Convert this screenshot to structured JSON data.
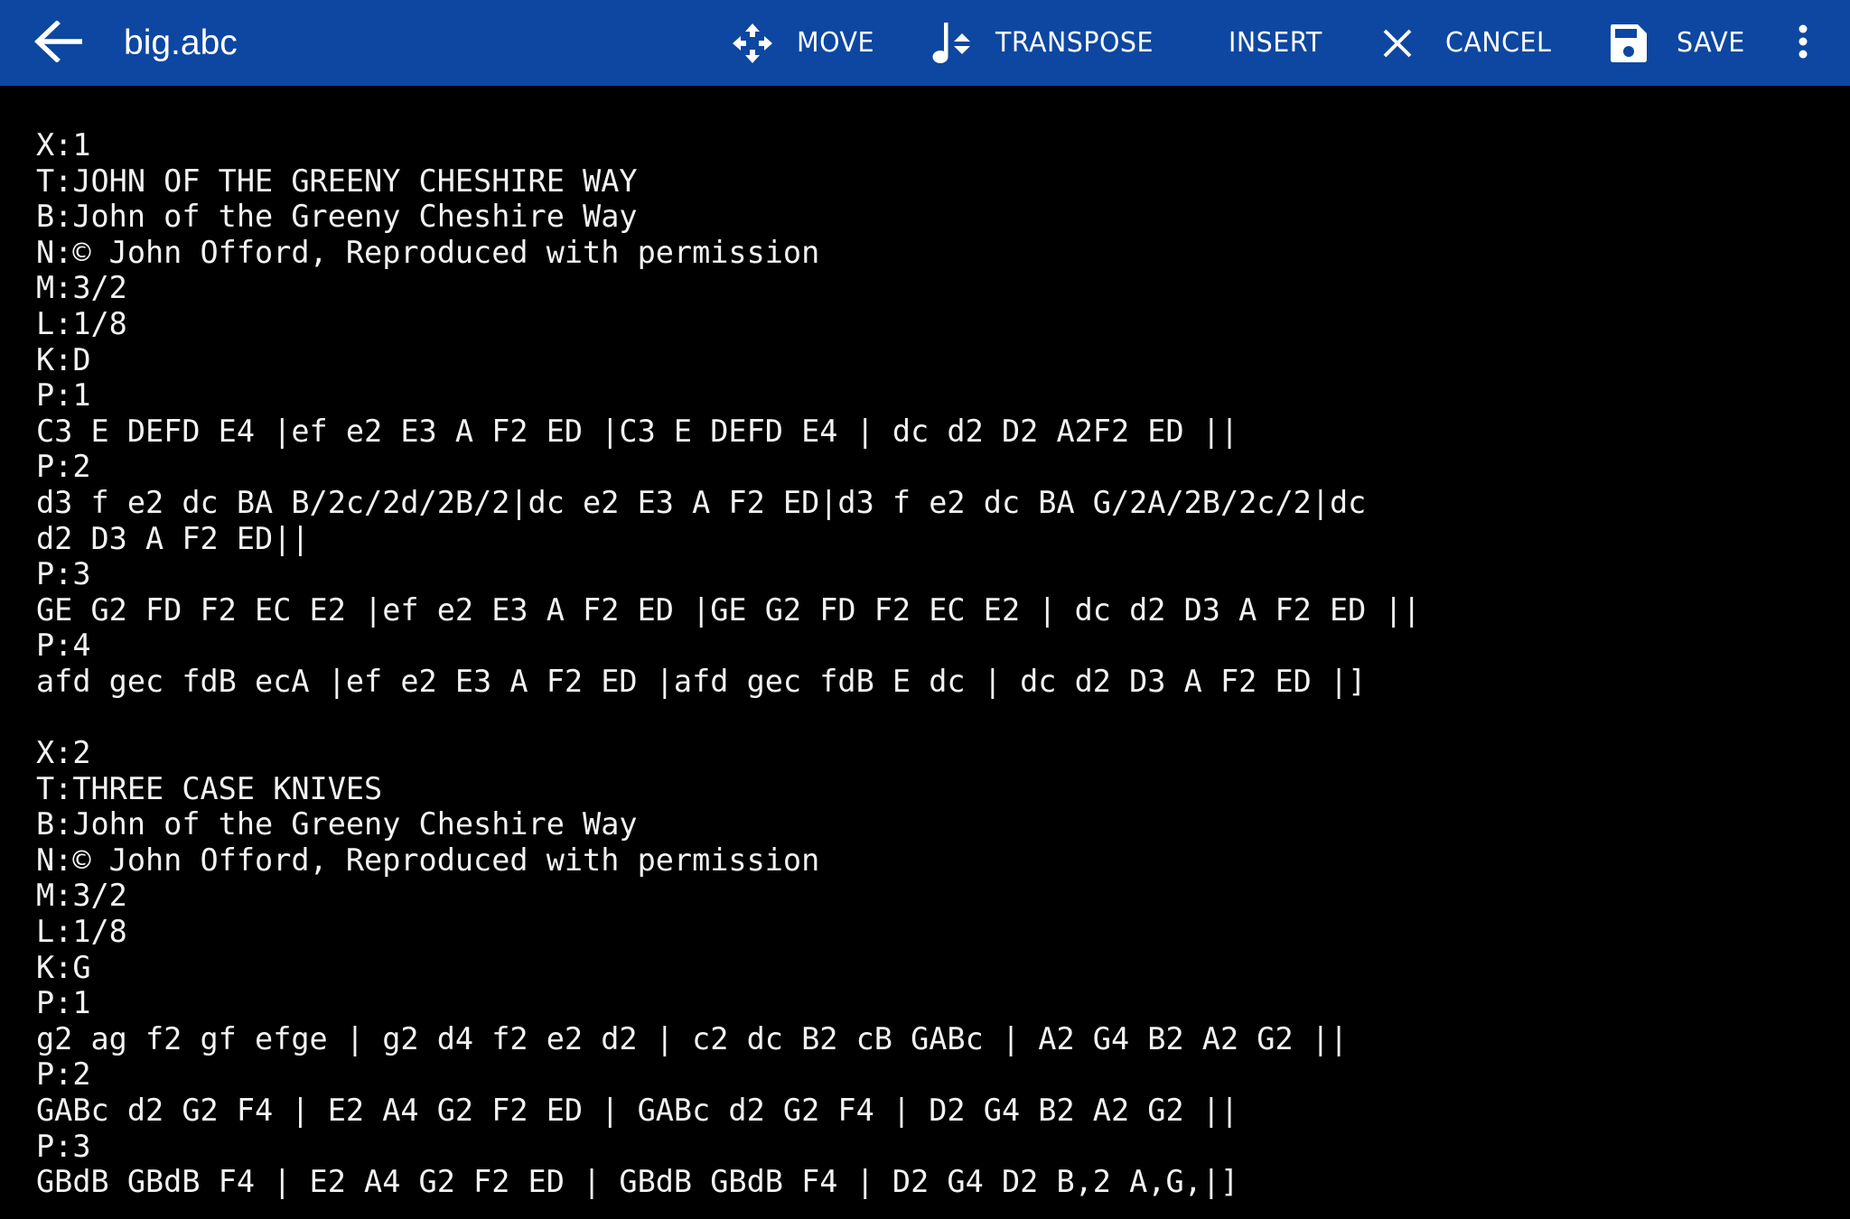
{
  "toolbar": {
    "back_icon": "arrow-left-icon",
    "title": "big.abc",
    "actions": [
      {
        "id": "move",
        "label": "MOVE",
        "icon": "move-arrows-icon"
      },
      {
        "id": "transpose",
        "label": "TRANSPOSE",
        "icon": "note-transpose-icon"
      },
      {
        "id": "insert",
        "label": "INSERT",
        "icon": null
      },
      {
        "id": "cancel",
        "label": "CANCEL",
        "icon": "close-icon"
      },
      {
        "id": "save",
        "label": "SAVE",
        "icon": "floppy-disk-icon"
      }
    ],
    "overflow_icon": "more-vert-icon",
    "background_color": "#0D47A1"
  },
  "editor": {
    "lines": [
      "X:1",
      "T:JOHN OF THE GREENY CHESHIRE WAY",
      "B:John of the Greeny Cheshire Way",
      "N:© John Offord, Reproduced with permission",
      "M:3/2",
      "L:1/8",
      "K:D",
      "P:1",
      "C3 E DEFD E4 |ef e2 E3 A F2 ED |C3 E DEFD E4 | dc d2 D2 A2F2 ED ||",
      "P:2",
      "d3 f e2 dc BA B/2c/2d/2B/2|dc e2 E3 A F2 ED|d3 f e2 dc BA G/2A/2B/2c/2|dc",
      "d2 D3 A F2 ED||",
      "P:3",
      "GE G2 FD F2 EC E2 |ef e2 E3 A F2 ED |GE G2 FD F2 EC E2 | dc d2 D3 A F2 ED ||",
      "P:4",
      "afd gec fdB ecA |ef e2 E3 A F2 ED |afd gec fdB E dc | dc d2 D3 A F2 ED |]",
      "",
      "X:2",
      "T:THREE CASE KNIVES",
      "B:John of the Greeny Cheshire Way",
      "N:© John Offord, Reproduced with permission",
      "M:3/2",
      "L:1/8",
      "K:G",
      "P:1",
      "g2 ag f2 gf efge | g2 d4 f2 e2 d2 | c2 dc B2 cB GABc | A2 G4 B2 A2 G2 ||",
      "P:2",
      "GABc d2 G2 F4 | E2 A4 G2 F2 ED | GABc d2 G2 F4 | D2 G4 B2 A2 G2 ||",
      "P:3",
      "GBdB GBdB F4 | E2 A4 G2 F2 ED | GBdB GBdB F4 | D2 G4 D2 B,2 A,G,|]"
    ]
  }
}
